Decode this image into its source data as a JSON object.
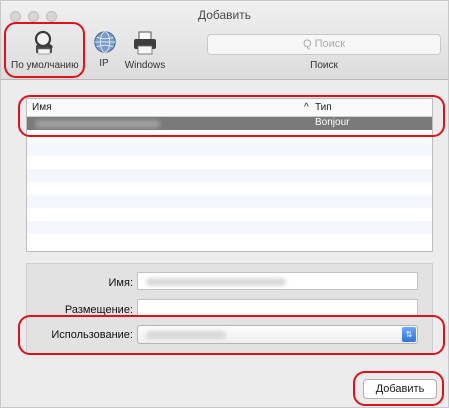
{
  "window": {
    "title": "Добавить"
  },
  "toolbar": {
    "default_label": "По умолчанию",
    "ip_label": "IP",
    "windows_label": "Windows",
    "search_placeholder": "Q Поиск",
    "search_label": "Поиск",
    "icons": {
      "default": "printer-magnifier-icon",
      "ip": "globe-icon",
      "windows": "printer-icon"
    }
  },
  "list": {
    "columns": {
      "name": "Имя",
      "sort_indicator": "^",
      "type": "Тип"
    },
    "rows": [
      {
        "name": "",
        "type": "Bonjour",
        "selected": true
      }
    ]
  },
  "form": {
    "name_label": "Имя:",
    "name_value": "",
    "location_label": "Размещение:",
    "location_value": "",
    "use_label": "Использование:",
    "use_value": ""
  },
  "actions": {
    "add_label": "Добавить"
  },
  "colors": {
    "annotation_ring": "#e0111b",
    "selection": "#7a7a7a",
    "stepper": "#2b74e4"
  }
}
